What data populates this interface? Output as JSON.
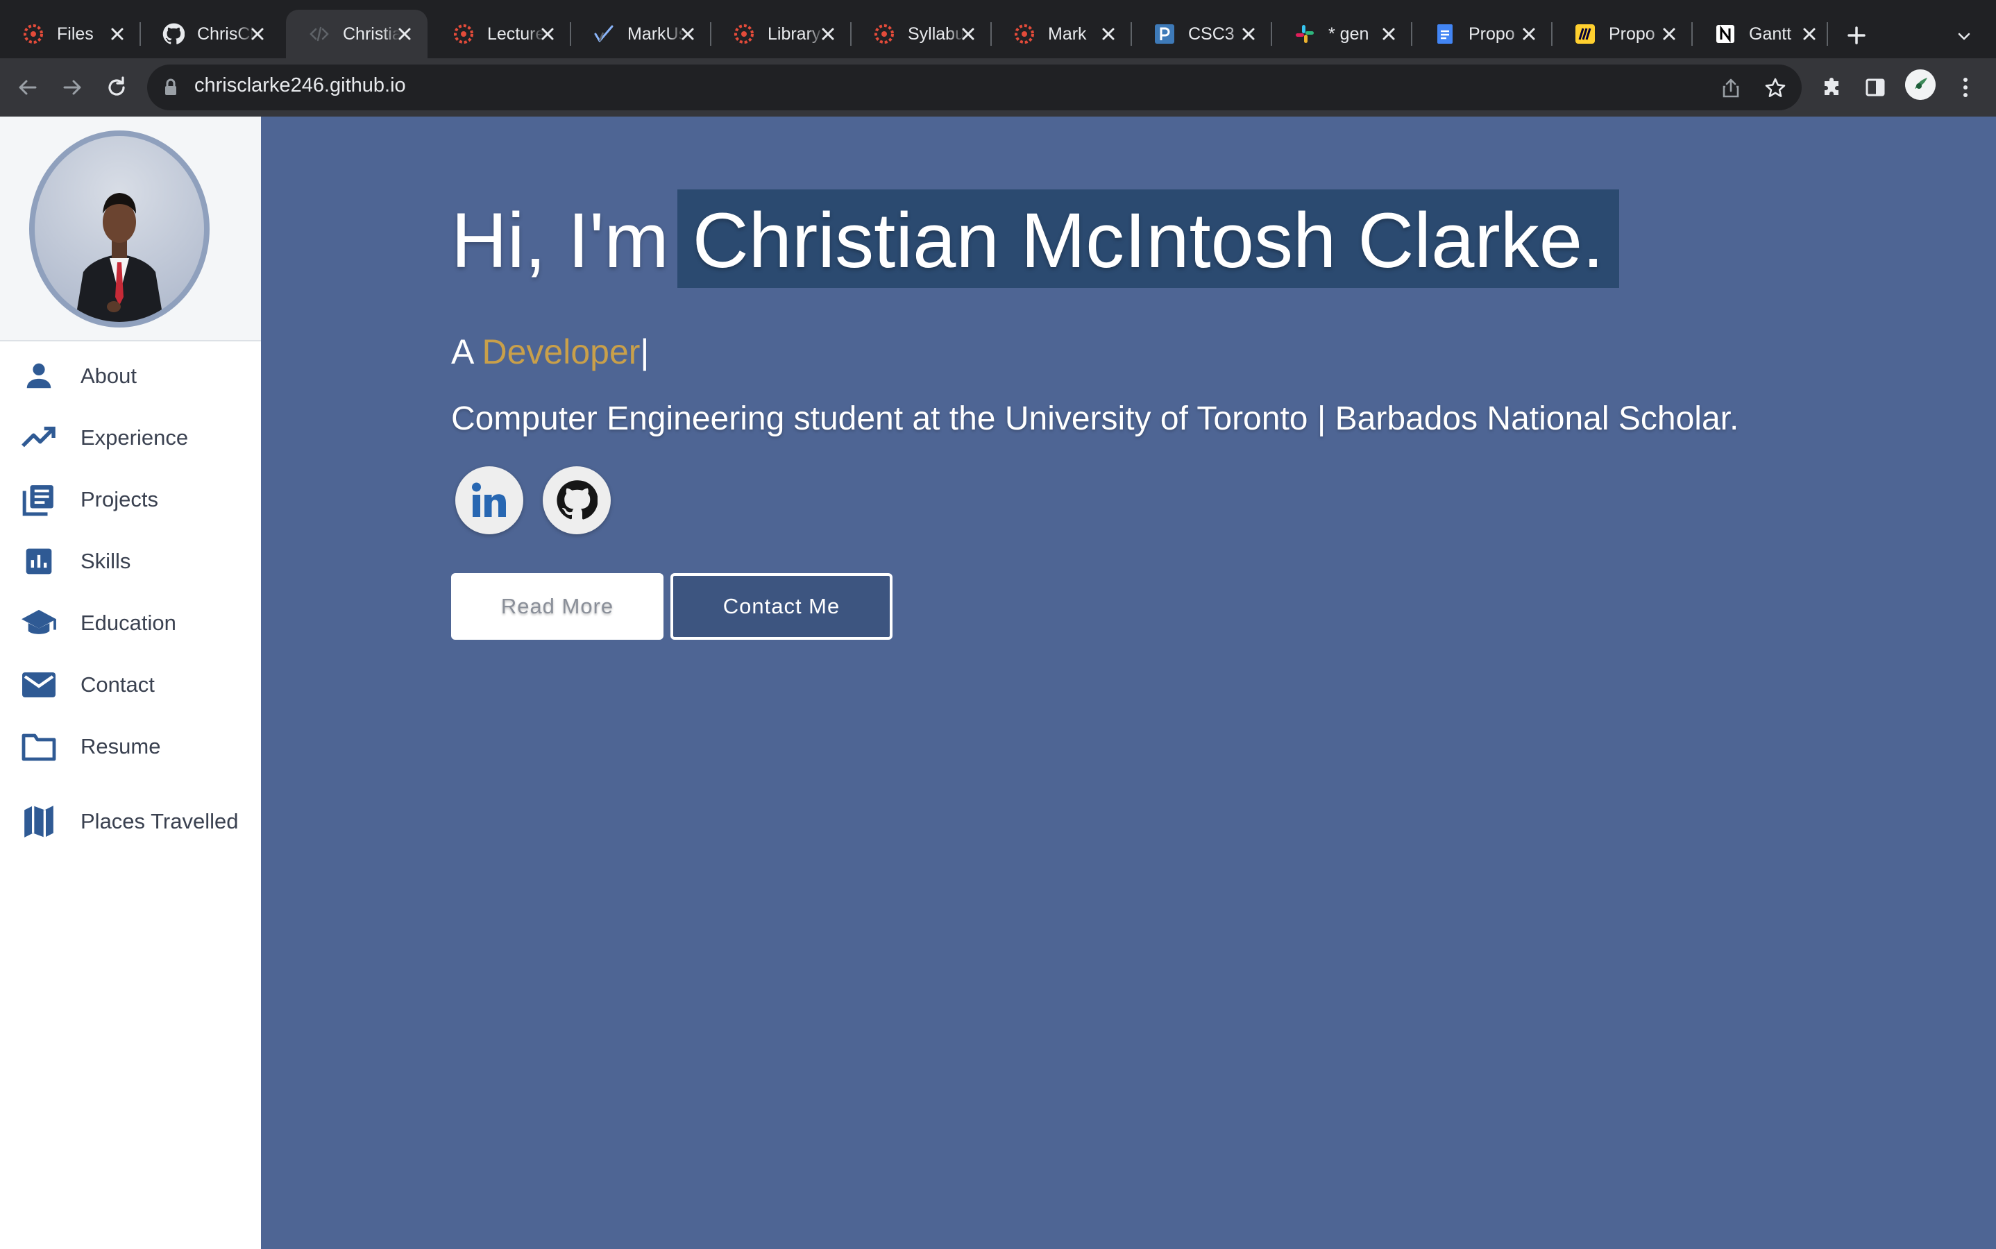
{
  "browser": {
    "tabs": [
      {
        "title": "Files",
        "icon": "canvas-icon",
        "active": false
      },
      {
        "title": "ChrisClarke",
        "icon": "github-icon",
        "active": false
      },
      {
        "title": "Christian",
        "icon": "code-icon",
        "active": true
      },
      {
        "title": "Lecture",
        "icon": "canvas-icon",
        "active": false
      },
      {
        "title": "MarkUs",
        "icon": "markus-icon",
        "active": false
      },
      {
        "title": "Library",
        "icon": "canvas-icon",
        "active": false
      },
      {
        "title": "Syllabus",
        "icon": "canvas-icon",
        "active": false
      },
      {
        "title": "Mark",
        "icon": "canvas-icon",
        "active": false
      },
      {
        "title": "CSC3",
        "icon": "piazza-icon",
        "active": false
      },
      {
        "title": "* gen",
        "icon": "slack-icon",
        "active": false
      },
      {
        "title": "Propo",
        "icon": "docs-icon",
        "active": false
      },
      {
        "title": "Propo",
        "icon": "miro-icon",
        "active": false
      },
      {
        "title": "Gantt",
        "icon": "notion-icon",
        "active": false
      }
    ],
    "url": "chrisclarke246.github.io"
  },
  "sidebar": {
    "items": [
      {
        "label": "About",
        "icon": "person-icon"
      },
      {
        "label": "Experience",
        "icon": "trending-up-icon"
      },
      {
        "label": "Projects",
        "icon": "library-books-icon"
      },
      {
        "label": "Skills",
        "icon": "bar-chart-icon"
      },
      {
        "label": "Education",
        "icon": "graduation-cap-icon"
      },
      {
        "label": "Contact",
        "icon": "mail-icon"
      },
      {
        "label": "Resume",
        "icon": "folder-icon"
      },
      {
        "label": "Places Travelled",
        "icon": "map-icon"
      }
    ]
  },
  "hero": {
    "greeting": "Hi, I'm",
    "name": "Christian McIntosh Clarke.",
    "role_prefix": "A",
    "role": "Developer",
    "cursor": "|",
    "tagline": "Computer Engineering student at the University of Toronto | Barbados National Scholar.",
    "read_more": "Read More",
    "contact_me": "Contact Me"
  },
  "colors": {
    "page_bg": "#4e6594",
    "name_highlight": "#2b4a70",
    "role_accent": "#c9a04a",
    "sidebar_icon": "#2f5a94"
  }
}
